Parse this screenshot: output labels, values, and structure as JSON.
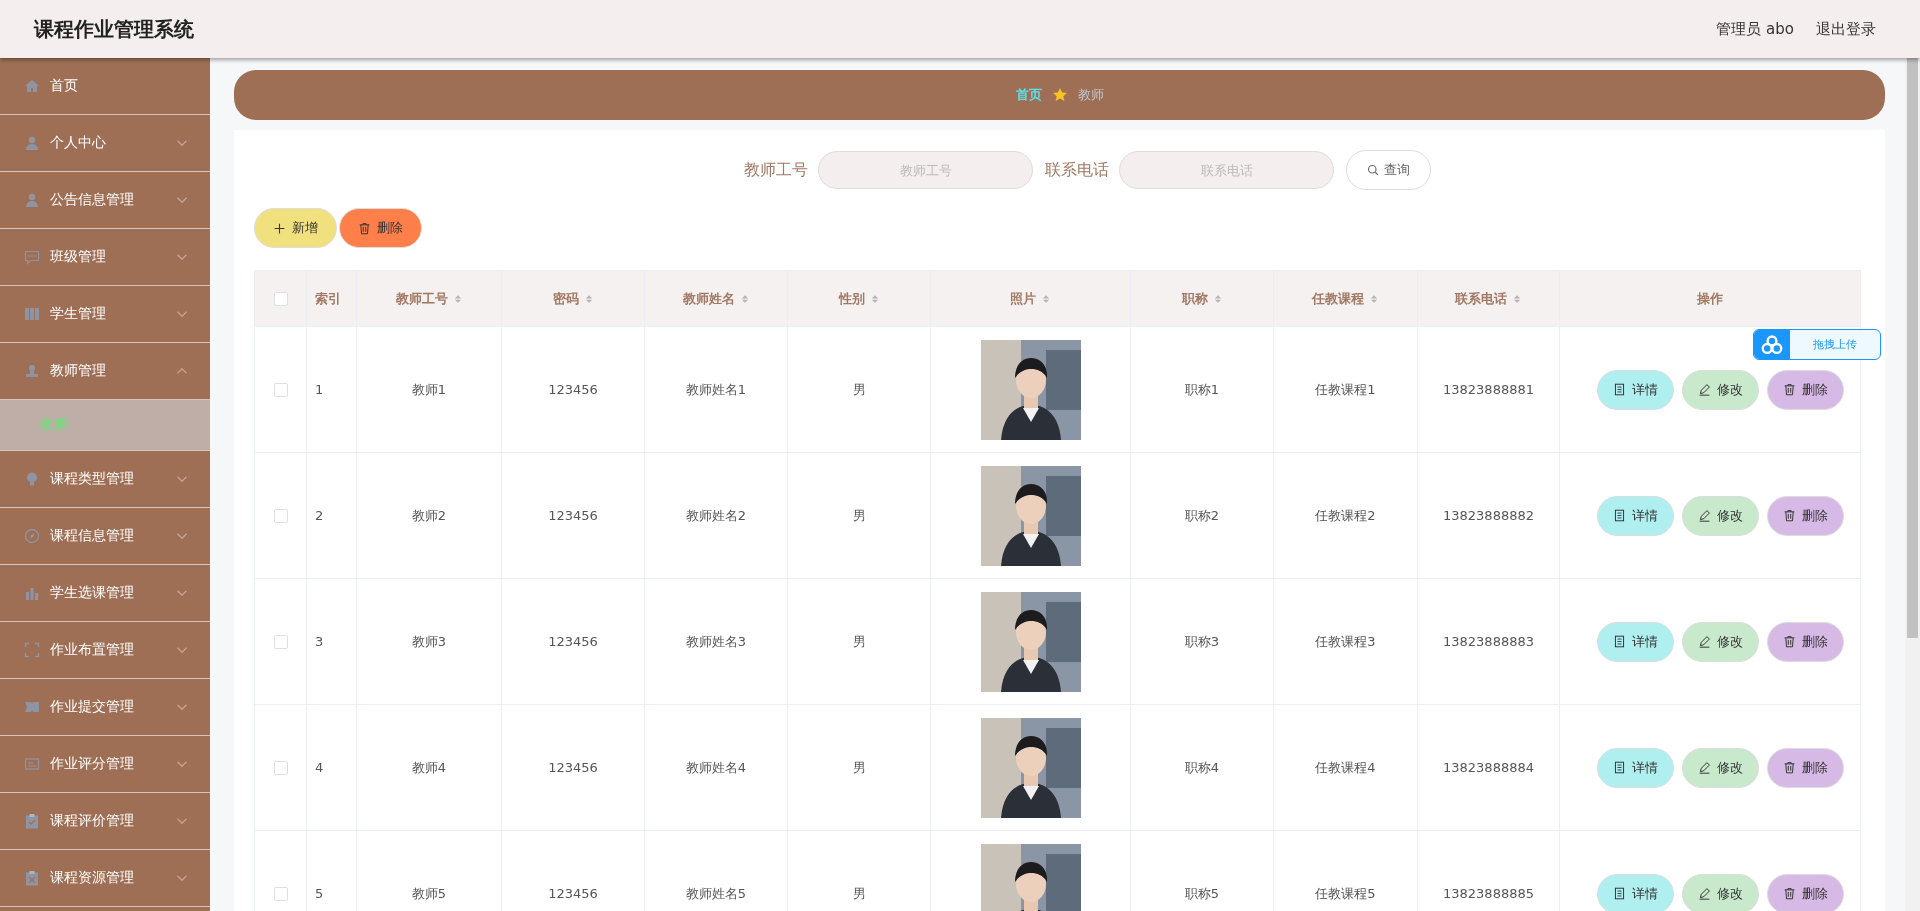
{
  "header": {
    "title": "课程作业管理系统",
    "user": "管理员 abo",
    "logout": "退出登录"
  },
  "sidebar": {
    "items": [
      {
        "label": "首页"
      },
      {
        "label": "个人中心",
        "expanded": false
      },
      {
        "label": "公告信息管理",
        "expanded": false
      },
      {
        "label": "班级管理",
        "expanded": false
      },
      {
        "label": "学生管理",
        "expanded": false
      },
      {
        "label": "教师管理",
        "expanded": true,
        "children": [
          {
            "label": "教师",
            "selected": true
          }
        ]
      },
      {
        "label": "课程类型管理",
        "expanded": false
      },
      {
        "label": "课程信息管理",
        "expanded": false
      },
      {
        "label": "学生选课管理",
        "expanded": false
      },
      {
        "label": "作业布置管理",
        "expanded": false
      },
      {
        "label": "作业提交管理",
        "expanded": false
      },
      {
        "label": "作业评分管理",
        "expanded": false
      },
      {
        "label": "课程评价管理",
        "expanded": false
      },
      {
        "label": "课程资源管理",
        "expanded": false
      }
    ]
  },
  "breadcrumb": [
    {
      "label": "首页",
      "selected": true
    },
    {
      "label": "教师",
      "selected": false
    }
  ],
  "search": {
    "fields": [
      {
        "label": "教师工号",
        "placeholder": "教师工号"
      },
      {
        "label": "联系电话",
        "placeholder": "联系电话"
      }
    ],
    "button": "查询"
  },
  "actions": [
    {
      "label": "新增",
      "kind": "add"
    },
    {
      "label": "删除",
      "kind": "delete"
    }
  ],
  "upload_badge": "拖拽上传",
  "table": {
    "select_all": {
      "checked": false
    },
    "columns": [
      {
        "label": "索引",
        "sortable": false
      },
      {
        "label": "教师工号",
        "sortable": true
      },
      {
        "label": "密码",
        "sortable": true
      },
      {
        "label": "教师姓名",
        "sortable": true
      },
      {
        "label": "性别",
        "sortable": true
      },
      {
        "label": "照片",
        "sortable": true
      },
      {
        "label": "职称",
        "sortable": true
      },
      {
        "label": "任教课程",
        "sortable": true
      },
      {
        "label": "联系电话",
        "sortable": true
      },
      {
        "label": "操作",
        "sortable": false
      }
    ],
    "rows": [
      {
        "checked": false,
        "cells": [
          "1",
          "教师1",
          "123456",
          "教师姓名1",
          "男",
          {
            "kind": "picture"
          },
          "职称1",
          "任教课程1",
          "13823888881"
        ],
        "buttons": [
          {
            "label": "详情",
            "kind": "detail"
          },
          {
            "label": "修改",
            "kind": "edit"
          },
          {
            "label": "删除",
            "kind": "delete"
          }
        ]
      },
      {
        "checked": false,
        "cells": [
          "2",
          "教师2",
          "123456",
          "教师姓名2",
          "男",
          {
            "kind": "picture"
          },
          "职称2",
          "任教课程2",
          "13823888882"
        ],
        "buttons": [
          {
            "label": "详情",
            "kind": "detail"
          },
          {
            "label": "修改",
            "kind": "edit"
          },
          {
            "label": "删除",
            "kind": "delete"
          }
        ]
      },
      {
        "checked": false,
        "cells": [
          "3",
          "教师3",
          "123456",
          "教师姓名3",
          "男",
          {
            "kind": "picture"
          },
          "职称3",
          "任教课程3",
          "13823888883"
        ],
        "buttons": [
          {
            "label": "详情",
            "kind": "detail"
          },
          {
            "label": "修改",
            "kind": "edit"
          },
          {
            "label": "删除",
            "kind": "delete"
          }
        ]
      },
      {
        "checked": false,
        "cells": [
          "4",
          "教师4",
          "123456",
          "教师姓名4",
          "男",
          {
            "kind": "picture"
          },
          "职称4",
          "任教课程4",
          "13823888884"
        ],
        "buttons": [
          {
            "label": "详情",
            "kind": "detail"
          },
          {
            "label": "修改",
            "kind": "edit"
          },
          {
            "label": "删除",
            "kind": "delete"
          }
        ]
      },
      {
        "checked": false,
        "cells": [
          "5",
          "教师5",
          "123456",
          "教师姓名5",
          "男",
          {
            "kind": "picture"
          },
          "职称5",
          "任教课程5",
          "13823888885"
        ],
        "buttons": [
          {
            "label": "详情",
            "kind": "detail"
          },
          {
            "label": "修改",
            "kind": "edit"
          },
          {
            "label": "删除",
            "kind": "delete"
          }
        ]
      }
    ]
  }
}
